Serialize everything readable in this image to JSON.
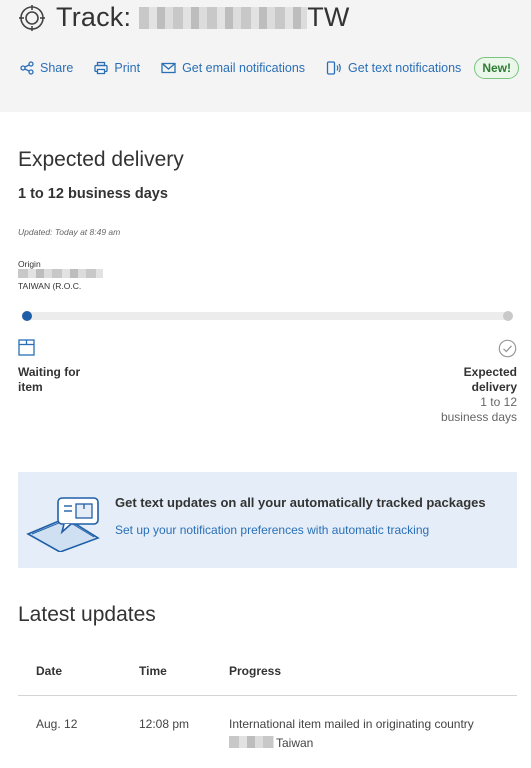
{
  "header": {
    "title_prefix": "Track:",
    "title_suffix": "TW",
    "actions": {
      "share": "Share",
      "print": "Print",
      "email": "Get email notifications",
      "text": "Get text notifications",
      "new_badge": "New!"
    }
  },
  "delivery": {
    "heading": "Expected delivery",
    "range": "1 to 12 business days",
    "updated": "Updated: Today at 8:49 am",
    "origin_label": "Origin",
    "origin_country": "TAIWAN (R.O.C.",
    "status_left_line1": "Waiting for",
    "status_left_line2": "item",
    "status_right_line1": "Expected",
    "status_right_line2": "delivery",
    "status_right_line3": "1 to 12",
    "status_right_line4": "business days",
    "progress": 0
  },
  "promo": {
    "title": "Get text updates on all your automatically tracked packages",
    "link": "Set up your notification preferences with automatic tracking"
  },
  "updates": {
    "heading": "Latest updates",
    "columns": [
      "Date",
      "Time",
      "Progress"
    ],
    "rows": [
      {
        "date": "Aug. 12",
        "time": "12:08 pm",
        "progress": "International item mailed in originating country",
        "location": "Taiwan"
      }
    ]
  },
  "colors": {
    "accent": "#2a6fb6",
    "progress_dot": "#1f5fa8",
    "badge_green": "#2e7d32",
    "promo_bg": "#e5eef8"
  }
}
